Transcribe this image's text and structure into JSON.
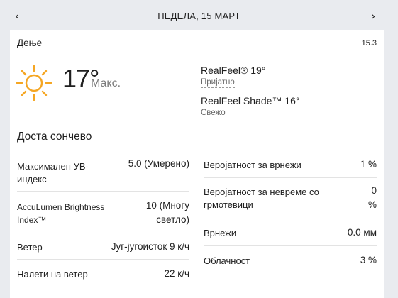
{
  "nav": {
    "date": "НЕДЕЛА, 15 МАРТ",
    "prev_icon": "chevron-left-icon",
    "next_icon": "chevron-right-icon",
    "prev_glyph": "‹",
    "next_glyph": "›"
  },
  "header": {
    "title": "Дење",
    "time": "15.3"
  },
  "current": {
    "temperature": "17°",
    "temp_label": "Макс.",
    "icon": "sun-icon",
    "sun_color": "#f5a623",
    "realfeel": "RealFeel® 19°",
    "realfeel_desc": "Пријатно",
    "realfeel_shade": "RealFeel Shade™ 16°",
    "realfeel_shade_desc": "Свежо",
    "phrase": "Доста сончево"
  },
  "details_left": [
    {
      "label": "Максимален УВ-индекс",
      "value": "5.0 (Умерено)"
    },
    {
      "label": "AccuLumen Brightness Index™",
      "value": "10 (Многу светло)"
    },
    {
      "label": "Ветер",
      "value": "Југ-југоисток 9 к/ч"
    },
    {
      "label": "Налети на ветер",
      "value": "22 к/ч"
    }
  ],
  "details_right": [
    {
      "label": "Веројатност за врнежи",
      "value": "1 %"
    },
    {
      "label": "Веројатност за невреме со грмотевици",
      "value": "0 %"
    },
    {
      "label": "Врнежи",
      "value": "0.0 мм"
    },
    {
      "label": "Облачност",
      "value": "3 %"
    }
  ]
}
